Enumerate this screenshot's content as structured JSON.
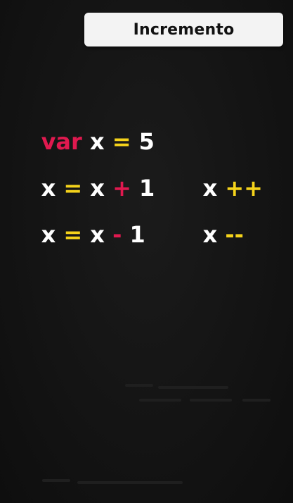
{
  "title": "Incremento",
  "colors": {
    "keyword": "#e0194f",
    "operator_yellow": "#f5d31b",
    "operator_red": "#e0194f",
    "text": "#ffffff",
    "background": "#141414",
    "title_bg": "#f3f3f3",
    "title_text": "#111111"
  },
  "lines": {
    "declaration": {
      "keyword": "var",
      "name": "x",
      "assign": "=",
      "value": "5"
    },
    "increment_long": {
      "target": "x",
      "assign": "=",
      "operand": "x",
      "operator": "+",
      "amount": "1"
    },
    "decrement_long": {
      "target": "x",
      "assign": "=",
      "operand": "x",
      "operator": "-",
      "amount": "1"
    },
    "increment_short": {
      "name": "x",
      "operator": "++"
    },
    "decrement_short": {
      "name": "x",
      "operator": "--"
    }
  }
}
